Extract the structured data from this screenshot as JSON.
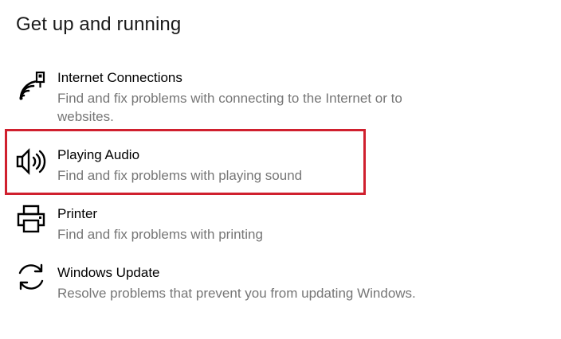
{
  "section": {
    "title": "Get up and running"
  },
  "items": [
    {
      "title": "Internet Connections",
      "description": "Find and fix problems with connecting to the Internet or to websites.",
      "icon": "wifi-signal-icon"
    },
    {
      "title": "Playing Audio",
      "description": "Find and fix problems with playing sound",
      "icon": "speaker-icon",
      "highlighted": true
    },
    {
      "title": "Printer",
      "description": "Find and fix problems with printing",
      "icon": "printer-icon"
    },
    {
      "title": "Windows Update",
      "description": "Resolve problems that prevent you from updating Windows.",
      "icon": "refresh-icon"
    }
  ],
  "colors": {
    "highlight_border": "#d0202e",
    "description_text": "#767676"
  }
}
